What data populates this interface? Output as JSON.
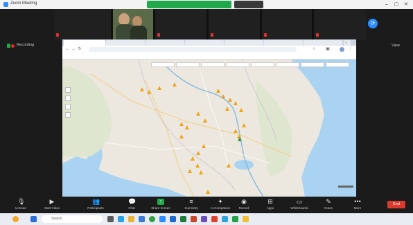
{
  "window": {
    "title": "Zoom Meeting"
  },
  "share_indicator": {
    "status": "",
    "view_options": ""
  },
  "participants": [
    {
      "name": "",
      "sub": ""
    },
    {
      "name": "",
      "sub": ""
    },
    {
      "name": "",
      "sub": ""
    },
    {
      "name": "",
      "sub": ""
    },
    {
      "name": "",
      "sub": ""
    }
  ],
  "recording": {
    "label": "Recording"
  },
  "view_button": {
    "label": "View"
  },
  "browser": {
    "tabs": [
      "",
      "",
      "",
      "",
      "",
      "",
      ""
    ],
    "url": "",
    "bookmarks": [
      "",
      "",
      "",
      "",
      "",
      "",
      "",
      "",
      "",
      ""
    ],
    "map_filters": [
      "",
      "",
      "",
      "",
      "",
      "",
      "",
      ""
    ]
  },
  "map": {
    "land_color": "#ece8df",
    "water_color": "#aad3f2",
    "marker_color": "#f2a317",
    "selected_marker_color": "#2e9e3a"
  },
  "toolbar": {
    "items": [
      "Unmute",
      "Start Video",
      "Participants",
      "Chat",
      "Share Screen",
      "Summary",
      "AI Companion",
      "Record",
      "Apps",
      "Whiteboards",
      "Notes",
      "More"
    ],
    "end_label": "End"
  },
  "taskbar": {
    "search_placeholder": "Search",
    "time": "",
    "date": ""
  }
}
